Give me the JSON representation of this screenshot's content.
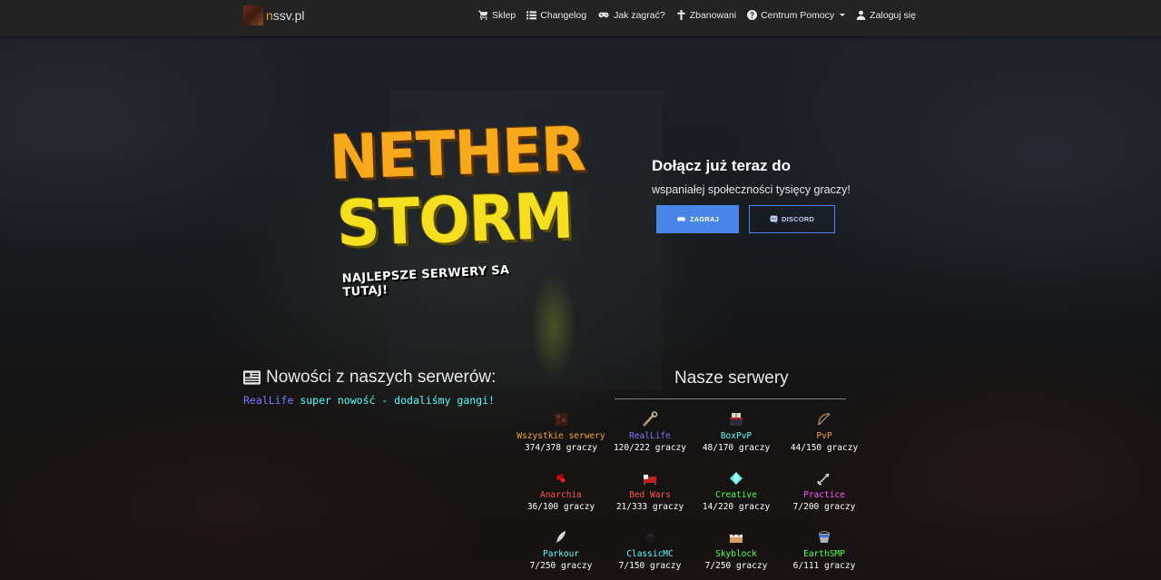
{
  "navbar": {
    "brand_first": "n",
    "brand_rest": "ssv.pl",
    "items": [
      {
        "label": "Sklep",
        "icon": "cart-icon"
      },
      {
        "label": "Changelog",
        "icon": "list-icon"
      },
      {
        "label": "Jak zagrać?",
        "icon": "gamepad-icon"
      },
      {
        "label": "Zbanowani",
        "icon": "cross-icon"
      },
      {
        "label": "Centrum Pomocy",
        "icon": "question-icon"
      },
      {
        "label": "Zaloguj się",
        "icon": "user-icon"
      }
    ]
  },
  "hero": {
    "logo_line1": "NETHER",
    "logo_line2": "STORM",
    "logo_tagline": "NAJLEPSZE SERWERY SA TUTAJ!",
    "join_title": "Dołącz już teraz do",
    "join_subtitle": "wspaniałej społeczności tysięcy graczy!",
    "play_button": "ZAGRAJ",
    "discord_button": "DISCORD"
  },
  "news": {
    "title": "Nowości z naszych serwerów:",
    "item_tag": "RealLife",
    "item_text": "super nowość - dodaliśmy gangi!"
  },
  "servers": {
    "title": "Nasze serwery",
    "list": [
      {
        "name": "Wszystkie serwery",
        "count": "374/378 graczy",
        "color": "#f5a623",
        "icon": "netherrack-block-icon"
      },
      {
        "name": "RealLife",
        "count": "120/222 graczy",
        "color": "#7b7bff",
        "icon": "lead-icon"
      },
      {
        "name": "BoxPvP",
        "count": "48/170 graczy",
        "color": "#55ffff",
        "icon": "enchanting-table-icon"
      },
      {
        "name": "PvP",
        "count": "44/150 graczy",
        "color": "#f5a623",
        "icon": "bow-icon"
      },
      {
        "name": "Anarchia",
        "count": "36/100 graczy",
        "color": "#ff5555",
        "icon": "redstone-icon"
      },
      {
        "name": "Bed Wars",
        "count": "21/333 graczy",
        "color": "#ff5555",
        "icon": "bed-icon"
      },
      {
        "name": "Creative",
        "count": "14/220 graczy",
        "color": "#55ff55",
        "icon": "diamond-icon"
      },
      {
        "name": "Practice",
        "count": "7/200 graczy",
        "color": "#ff55ff",
        "icon": "arrow-icon"
      },
      {
        "name": "Parkour",
        "count": "7/250 graczy",
        "color": "#55ffff",
        "icon": "feather-icon"
      },
      {
        "name": "ClassicMC",
        "count": "7/150 graczy",
        "color": "#55ffff",
        "icon": "coal-icon"
      },
      {
        "name": "Skyblock",
        "count": "7/250 graczy",
        "color": "#55ff55",
        "icon": "cake-icon"
      },
      {
        "name": "EarthSMP",
        "count": "6/111 graczy",
        "color": "#55ff55",
        "icon": "water-bucket-icon"
      }
    ]
  }
}
